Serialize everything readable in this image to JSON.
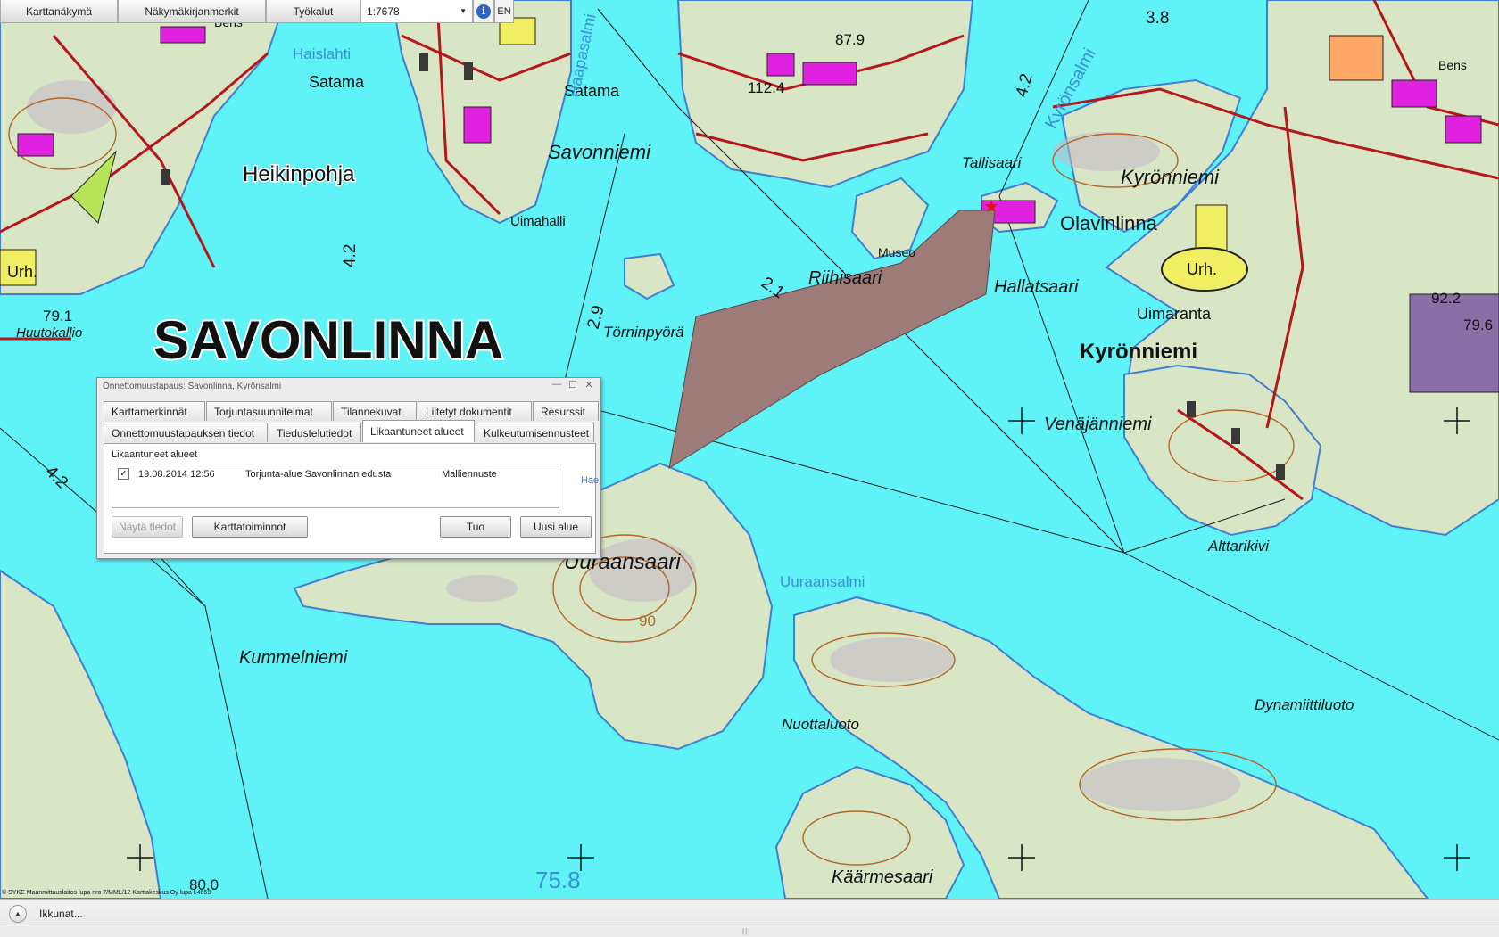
{
  "toolbar": {
    "items": [
      "Karttanäkymä",
      "Näkymäkirjanmerkit",
      "Työkalut"
    ],
    "scale": "1:7678",
    "lang": "EN"
  },
  "map": {
    "city": "SAVONLINNA",
    "places": [
      "Heikinpohja",
      "Olavinlinna",
      "Kyrönniemi",
      "Kyrönniemi",
      "Uuraansaari",
      "Satama",
      "Satama",
      "Savonniemi",
      "Uimahalli",
      "Tallisaari",
      "Hallatsaari",
      "Uimaranta",
      "Urh.",
      "Urh.",
      "Museo",
      "Riihisaari",
      "Törninpyörä",
      "Venäjänniemi",
      "Alttarikivi",
      "Kummelniemi",
      "Nuottaluoto",
      "Dynamiittiluoto",
      "Käärmesaari",
      "Huutokallio",
      "Bens",
      "Bens"
    ],
    "waters": [
      "Haislahti",
      "Haapasalmi",
      "Kyrönsalmi",
      "Uuraansalmi"
    ],
    "depths": [
      "4.2",
      "4.2",
      "4.2",
      "2.9",
      "3.8",
      "2.1"
    ],
    "heights": [
      "79.1",
      "87.9",
      "92.2",
      "79.6",
      "112.4",
      "90",
      "80.0"
    ],
    "deep_value": "75.8"
  },
  "copyright": "© SYKE Maanmittauslaitos lupa nro 7/MML/12 Karttakeskus Oy lupa L4659",
  "dialog": {
    "title": "Onnettomuustapaus: Savonlinna, Kyrönsalmi",
    "tabs_row1": [
      "Karttamerkinnät",
      "Torjuntasuunnitelmat",
      "Tilannekuvat",
      "Liitetyt dokumentit",
      "Resurssit"
    ],
    "tabs_row2": [
      "Onnettomuustapauksen tiedot",
      "Tiedustelutiedot",
      "Likaantuneet alueet",
      "Kulkeutumisennusteet"
    ],
    "active_tab": "Likaantuneet alueet",
    "section_label": "Likaantuneet alueet",
    "rows": [
      {
        "checked": "✓",
        "date": "19.08.2014 12:56",
        "name": "Torjunta-alue Savonlinnan edusta",
        "type": "Malliennuste"
      }
    ],
    "hae": "Hae",
    "buttons": {
      "details": "Näytä tiedot",
      "map_functions": "Karttatoiminnot",
      "import": "Tuo",
      "new_area": "Uusi alue"
    }
  },
  "bottom": {
    "windows": "Ikkunat..."
  }
}
